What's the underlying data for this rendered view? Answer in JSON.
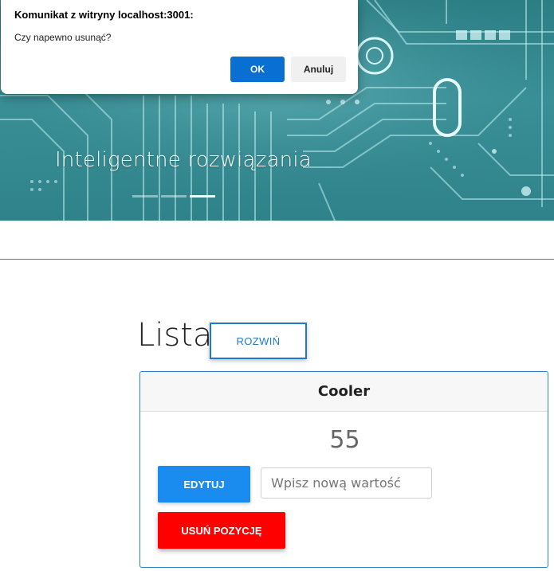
{
  "dialog": {
    "title": "Komunikat z witryny localhost:3001:",
    "message": "Czy napewno usunąć?",
    "ok_label": "OK",
    "cancel_label": "Anuluj"
  },
  "hero": {
    "caption": "Inteligentne rozwiązania",
    "slide_count": 3,
    "active_slide": 3
  },
  "list": {
    "title": "Lista",
    "expand_label": "ROZWIŃ"
  },
  "card": {
    "name": "Cooler",
    "value": "55",
    "edit_label": "EDYTUJ",
    "input_value": "",
    "input_placeholder": "Wpisz nową wartość",
    "delete_label": "USUŃ POZYCJĘ"
  },
  "colors": {
    "accent_blue": "#1a8cf0",
    "border_blue": "#2b84c6",
    "danger_red": "#ff0000",
    "dialog_ok": "#0a6fd3",
    "hero_teal": "#3a9097"
  }
}
